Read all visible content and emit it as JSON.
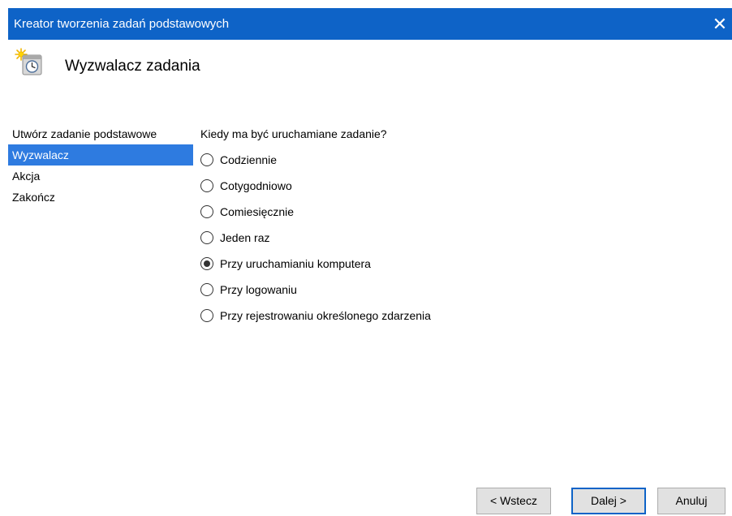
{
  "window": {
    "title": "Kreator tworzenia zadań podstawowych",
    "close_glyph": "✕"
  },
  "header": {
    "icon": "task-clock-icon",
    "title": "Wyzwalacz zadania"
  },
  "nav": {
    "items": [
      {
        "label": "Utwórz zadanie podstawowe",
        "selected": false
      },
      {
        "label": "Wyzwalacz",
        "selected": true
      },
      {
        "label": "Akcja",
        "selected": false
      },
      {
        "label": "Zakończ",
        "selected": false
      }
    ]
  },
  "content": {
    "question": "Kiedy ma być uruchamiane zadanie?",
    "options": [
      {
        "label": "Codziennie",
        "checked": false
      },
      {
        "label": "Cotygodniowo",
        "checked": false
      },
      {
        "label": "Comiesięcznie",
        "checked": false
      },
      {
        "label": "Jeden raz",
        "checked": false
      },
      {
        "label": "Przy uruchamianiu komputera",
        "checked": true
      },
      {
        "label": "Przy logowaniu",
        "checked": false
      },
      {
        "label": "Przy rejestrowaniu określonego zdarzenia",
        "checked": false
      }
    ]
  },
  "buttons": {
    "back": "< Wstecz",
    "next": "Dalej >",
    "cancel": "Anuluj"
  },
  "colors": {
    "titlebar": "#0e63c7",
    "selection": "#2e7be0",
    "button_face": "#e1e1e1",
    "default_button_border": "#0e63c7"
  }
}
